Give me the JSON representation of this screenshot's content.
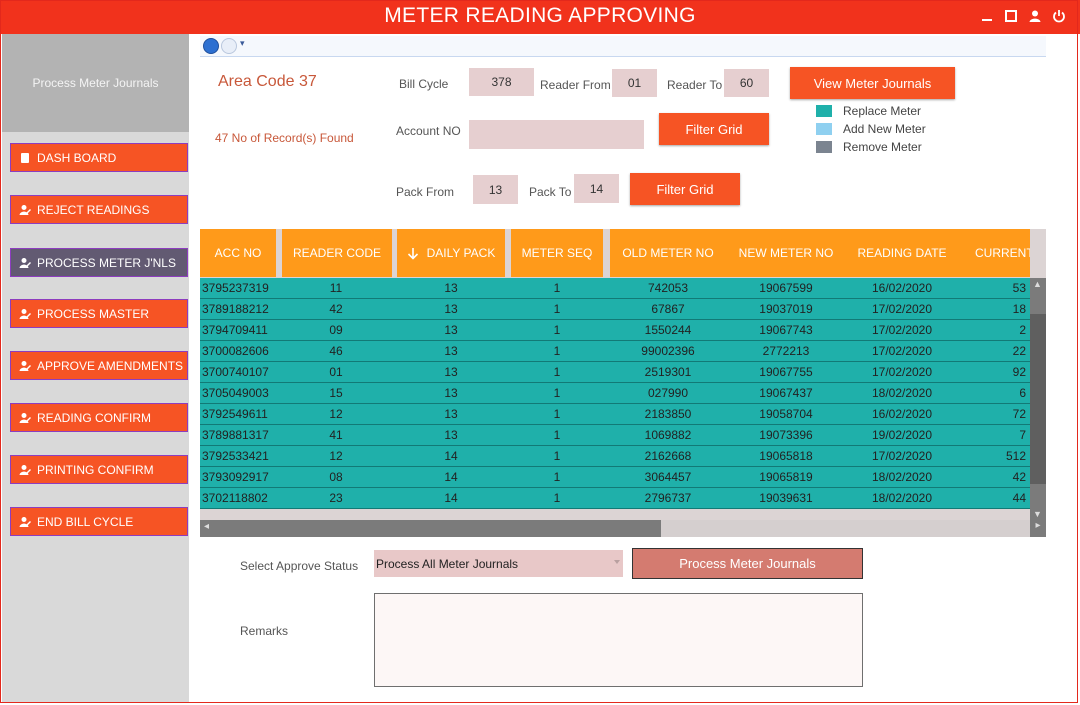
{
  "window": {
    "title": "METER READING APPROVING"
  },
  "sidebar": {
    "header": "Process Meter Journals",
    "items": [
      {
        "label": "DASH BOARD",
        "icon": "dashboard-icon"
      },
      {
        "label": "REJECT READINGS",
        "icon": "user-edit-icon"
      },
      {
        "label": "PROCESS METER J'NLS",
        "icon": "user-edit-icon"
      },
      {
        "label": "PROCESS MASTER",
        "icon": "user-edit-icon"
      },
      {
        "label": "APPROVE AMENDMENTS",
        "icon": "user-edit-icon"
      },
      {
        "label": "READING CONFIRM",
        "icon": "user-edit-icon"
      },
      {
        "label": "PRINTING CONFIRM",
        "icon": "user-edit-icon"
      },
      {
        "label": "END BILL CYCLE",
        "icon": "user-edit-icon"
      }
    ],
    "active_index": 2
  },
  "info": {
    "area_code": "Area Code 37",
    "records_found": "47 No of Record(s) Found"
  },
  "filters": {
    "bill_cycle_label": "Bill Cycle",
    "bill_cycle": "378",
    "reader_from_label": "Reader From",
    "reader_from": "01",
    "reader_to_label": "Reader To",
    "reader_to": "60",
    "account_no_label": "Account NO",
    "account_no": "",
    "pack_from_label": "Pack From",
    "pack_from": "13",
    "pack_to_label": "Pack To",
    "pack_to": "14",
    "filter_grid_label": "Filter Grid",
    "view_journals_label": "View Meter Journals"
  },
  "legend": [
    {
      "label": "Replace Meter",
      "color": "#1fb0aa"
    },
    {
      "label": "Add New Meter",
      "color": "#8fd0f0"
    },
    {
      "label": "Remove Meter",
      "color": "#7b8490"
    }
  ],
  "grid": {
    "columns": [
      "ACC NO",
      "READER CODE",
      "DAILY PACK",
      "METER SEQ",
      "OLD METER NO",
      "NEW METER NO",
      "READING DATE",
      "CURRENT"
    ],
    "rows": [
      [
        "3795237319",
        "11",
        "13",
        "1",
        "742053",
        "19067599",
        "16/02/2020",
        "53"
      ],
      [
        "3789188212",
        "42",
        "13",
        "1",
        "67867",
        "19037019",
        "17/02/2020",
        "18"
      ],
      [
        "3794709411",
        "09",
        "13",
        "1",
        "1550244",
        "19067743",
        "17/02/2020",
        "2"
      ],
      [
        "3700082606",
        "46",
        "13",
        "1",
        "99002396",
        "2772213",
        "17/02/2020",
        "22"
      ],
      [
        "3700740107",
        "01",
        "13",
        "1",
        "2519301",
        "19067755",
        "17/02/2020",
        "92"
      ],
      [
        "3705049003",
        "15",
        "13",
        "1",
        "027990",
        "19067437",
        "18/02/2020",
        "6"
      ],
      [
        "3792549611",
        "12",
        "13",
        "1",
        "2183850",
        "19058704",
        "16/02/2020",
        "72"
      ],
      [
        "3789881317",
        "41",
        "13",
        "1",
        "1069882",
        "19073396",
        "19/02/2020",
        "7"
      ],
      [
        "3792533421",
        "12",
        "14",
        "1",
        "2162668",
        "19065818",
        "17/02/2020",
        "512"
      ],
      [
        "3793092917",
        "08",
        "14",
        "1",
        "3064457",
        "19065819",
        "18/02/2020",
        "42"
      ],
      [
        "3702118802",
        "23",
        "14",
        "1",
        "2796737",
        "19039631",
        "18/02/2020",
        "44"
      ]
    ]
  },
  "approve": {
    "status_label": "Select Approve Status",
    "status_value": "Process All Meter Journals",
    "process_button": "Process Meter Journals",
    "remarks_label": "Remarks",
    "remarks_value": ""
  }
}
